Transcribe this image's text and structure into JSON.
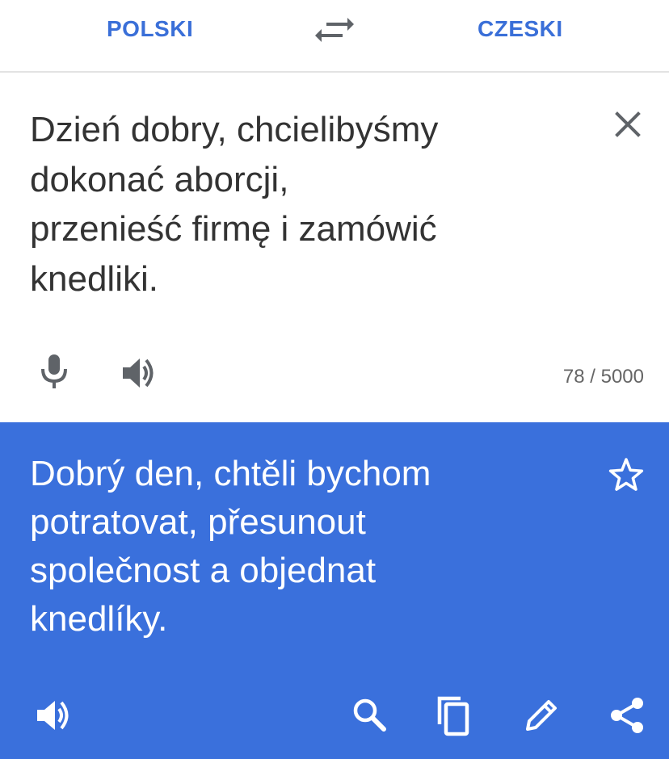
{
  "colors": {
    "accent": "#3a6fd8",
    "output_bg": "#3a70dc",
    "text_dark": "#333333",
    "icon_gray": "#5f6368",
    "white": "#ffffff"
  },
  "lang_bar": {
    "source_lang": "POLSKI",
    "target_lang": "CZESKI",
    "swap_icon": "swap-arrows-icon"
  },
  "input": {
    "text_lines": [
      "Dzień dobry, chcielibyśmy",
      "dokonać aborcji,",
      "przenieść firmę i zamówić",
      "knedliki."
    ],
    "char_count": "78 / 5000",
    "icons": {
      "clear": "close-icon",
      "mic": "microphone-icon",
      "speak": "speaker-icon"
    }
  },
  "output": {
    "text_lines": [
      "Dobrý den, chtěli bychom",
      "potratovat, přesunout",
      "společnost a objednat",
      "knedlíky."
    ],
    "icons": {
      "favorite": "star-outline-icon",
      "speak": "speaker-icon",
      "search": "search-icon",
      "copy": "copy-icon",
      "edit": "pencil-icon",
      "share": "share-icon"
    }
  }
}
